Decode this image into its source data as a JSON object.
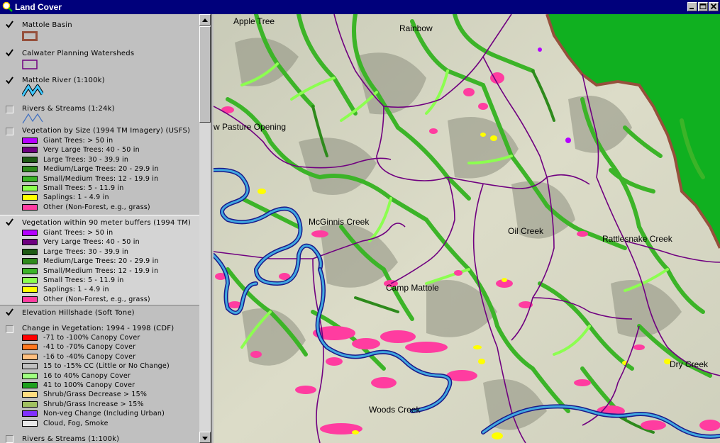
{
  "window": {
    "title": "Land Cover"
  },
  "legend": {
    "themes": [
      {
        "label": "Mattole Basin",
        "checked": true
      },
      {
        "label": "Calwater Planning Watersheds",
        "checked": true
      },
      {
        "label": "Mattole River (1:100k)",
        "checked": true
      },
      {
        "label": "Rivers & Streams (1:24k)",
        "checked": false
      },
      {
        "label": "Vegetation by Size (1994 TM Imagery) (USFS)",
        "checked": false
      },
      {
        "label": "Vegetation within 90 meter buffers (1994 TM)",
        "checked": true
      },
      {
        "label": "Elevation Hillshade (Soft Tone)",
        "checked": true
      },
      {
        "label": "Change in Vegetation: 1994 - 1998 (CDF)",
        "checked": false
      },
      {
        "label": "Rivers & Streams (1:100k)",
        "checked": false
      }
    ],
    "veg_classes_a": [
      {
        "label": "Giant Trees: > 50 in",
        "color": "#b400ff"
      },
      {
        "label": "Very Large Trees: 40 - 50 in",
        "color": "#6e0080"
      },
      {
        "label": "Large Trees: 30 - 39.9 in",
        "color": "#1e5a14"
      },
      {
        "label": "Medium/Large Trees: 20 - 29.9 in",
        "color": "#2e8a1c"
      },
      {
        "label": "Small/Medium Trees: 12 - 19.9 in",
        "color": "#3cb428"
      },
      {
        "label": "Small Trees: 5 - 11.9 in",
        "color": "#8cff50"
      },
      {
        "label": "Saplings: 1 - 4.9 in",
        "color": "#ffff00"
      },
      {
        "label": "Other (Non-Forest, e.g., grass)",
        "color": "#ff3ca0"
      }
    ],
    "veg_classes_b": [
      {
        "label": "Giant Trees: > 50 in",
        "color": "#b400ff"
      },
      {
        "label": "Very Large Trees: 40 - 50 in",
        "color": "#6e0080"
      },
      {
        "label": "Large Trees: 30 - 39.9 in",
        "color": "#1e5a14"
      },
      {
        "label": "Medium/Large Trees: 20 - 29.9 in",
        "color": "#2e8a1c"
      },
      {
        "label": "Small/Medium Trees: 12 - 19.9 in",
        "color": "#3cb428"
      },
      {
        "label": "Small Trees: 5 - 11.9 in",
        "color": "#8cff50"
      },
      {
        "label": "Saplings: 1 - 4.9 in",
        "color": "#ffff00"
      },
      {
        "label": "Other (Non-Forest, e.g., grass)",
        "color": "#ff3ca0"
      }
    ],
    "change_classes": [
      {
        "label": "-71 to -100% Canopy Cover",
        "color": "#ff0000"
      },
      {
        "label": "-41 to -70% Canopy Cover",
        "color": "#ff7820"
      },
      {
        "label": "-16 to -40% Canopy Cover",
        "color": "#ffc080"
      },
      {
        "label": "15 to -15% CC (Little or No Change)",
        "color": "#c0c0c0"
      },
      {
        "label": "16 to 40% Canopy Cover",
        "color": "#a0ff80"
      },
      {
        "label": "41 to 100% Canopy Cover",
        "color": "#1ea01e"
      },
      {
        "label": "Shrub/Grass Decrease > 15%",
        "color": "#ffdc80"
      },
      {
        "label": "Shrub/Grass Increase > 15%",
        "color": "#a0c060"
      },
      {
        "label": "Non-veg Change (Including Urban)",
        "color": "#8030ff"
      },
      {
        "label": "Cloud, Fog, Smoke",
        "color": "#e8e8e8"
      }
    ]
  },
  "map": {
    "places": [
      "Apple Tree",
      "Rainbow",
      "w Pasture Opening",
      "McGinnis Creek",
      "Oil Creek",
      "Rattlesnake Creek",
      "Camp Mattole",
      "Dry Creek",
      "Woods Creek"
    ]
  },
  "colors": {
    "basin_outline": "#96503c",
    "watershed_lines": "#700080",
    "river": "#40a8e0",
    "ocean_green": "#10b020",
    "titlebar": "#00007b"
  }
}
